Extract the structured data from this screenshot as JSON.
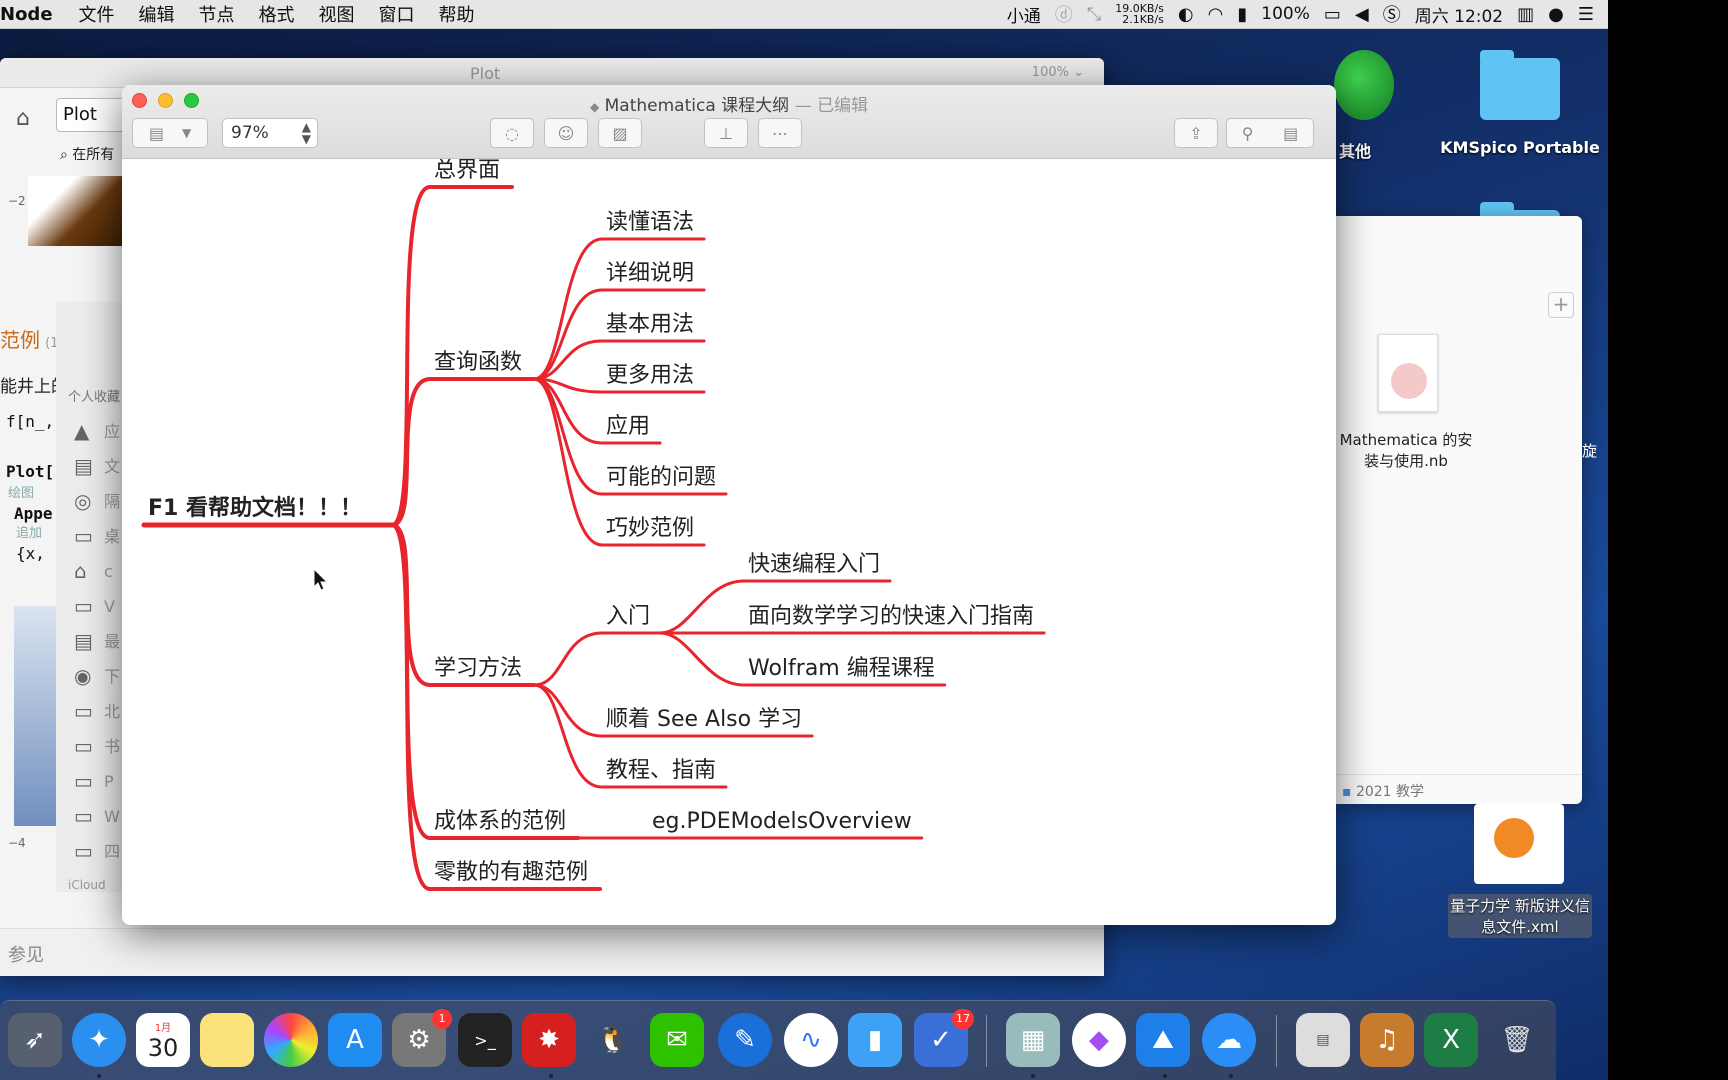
{
  "menubar": {
    "app": "Node",
    "menus": [
      "文件",
      "编辑",
      "节点",
      "格式",
      "视图",
      "窗口",
      "帮助"
    ],
    "im": "小通",
    "net_up": "19.0KB/s",
    "net_down": "2.1KB/s",
    "battery": "100%",
    "clock": "周六 12:02"
  },
  "plotwin": {
    "title": "Plot",
    "zoom": "100% ⌄",
    "search_value": "Plot",
    "scope": "在所有",
    "tick_neg2": "−2",
    "section": "范例",
    "section_count": "(1",
    "snippet_a": "能井上的",
    "code_f": "f[n_,",
    "code_plot": "Plot[",
    "note_plot": "绘图",
    "code_appe": "Appe",
    "note_append": "追加",
    "code_x": "{x,",
    "xtick_a": "−4",
    "xtick_b": "−2",
    "sidebar_head": "个人收藏",
    "sidebar_items": [
      "应",
      "文",
      "隔",
      "桌",
      "c",
      "V",
      "最",
      "下",
      "北",
      "书",
      "P",
      "W",
      "四"
    ],
    "icloud": "iCloud",
    "footer": "参见"
  },
  "mainwin": {
    "title": "Mathematica 课程大纲",
    "edited": "— 已编辑",
    "zoom": "97%"
  },
  "mindmap": {
    "root": "F1 看帮助文档！！！",
    "b1": "总界面",
    "b2": "查询函数",
    "b2_children": [
      "读懂语法",
      "详细说明",
      "基本用法",
      "更多用法",
      "应用",
      "可能的问题",
      "巧妙范例"
    ],
    "b3": "学习方法",
    "b3_intro": "入门",
    "b3_intro_children": [
      "快速编程入门",
      "面向数学学习的快速入门指南",
      "Wolfram 编程课程"
    ],
    "b3_others": [
      "顺着 See Also 学习",
      "教程、指南"
    ],
    "b4": "成体系的范例",
    "b4_child": "eg.PDEModelsOverview",
    "b5": "零散的有趣范例"
  },
  "finderwin": {
    "file_label": "Mathematica 的安装与使用.nb",
    "status": "2021 教学",
    "edge_char": "旋"
  },
  "desktop": {
    "other_label": "其他",
    "kms_label": "KMSpico Portable",
    "xml_label": "量子力学 新版讲义信息文件.xml"
  },
  "dock": {
    "calendar_month": "1月",
    "calendar_day": "30",
    "badge_settings": "1",
    "badge_tasks": "17"
  },
  "colors": {
    "branch": "#e8242c",
    "accent_orange": "#c86a16"
  }
}
